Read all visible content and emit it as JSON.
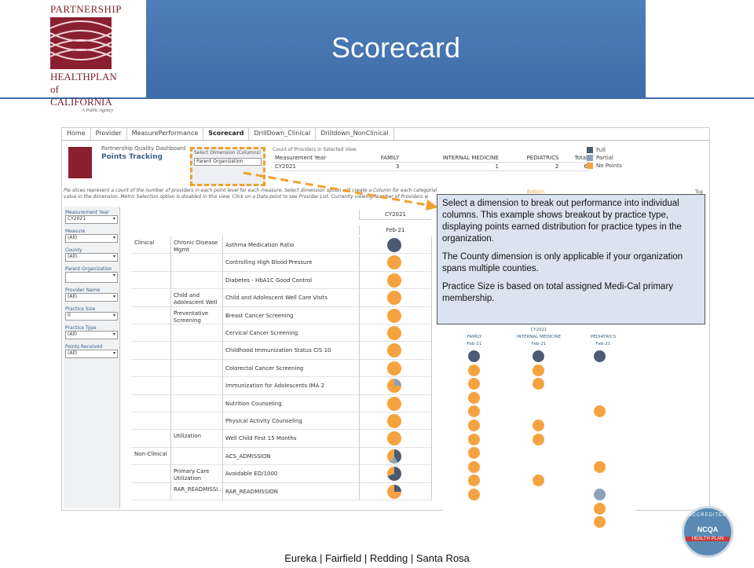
{
  "slide": {
    "title": "Scorecard",
    "footer": "Eureka   |   Fairfield   |   Redding   |   Santa Rosa"
  },
  "logo": {
    "line1": "PARTNERSHIP",
    "line2": "HEALTHPLAN",
    "line3": "of CALIFORNIA",
    "tagline": "A Public Agency"
  },
  "badge": {
    "top": "ACCREDITED",
    "mid": "NCQA",
    "bottom": "HEALTH PLAN"
  },
  "dashboard": {
    "tabs": [
      "Home",
      "Provider",
      "MeasurePerformance",
      "Scorecard",
      "DrillDown_Clinical",
      "Drilldown_NonClinical"
    ],
    "active_tab": "Scorecard",
    "title": "Partnership Quality Dashboard",
    "subtitle": "Points Tracking",
    "select_dimension_label": "Select Dimension (Columns)",
    "select_dimension_value": "Parent Organization",
    "count_caption": "Count of Providers in Selected View",
    "count_headers": [
      "Measurement Year",
      "FAMILY",
      "INTERNAL MEDICINE",
      "PEDIATRICS",
      "Total"
    ],
    "count_row": [
      "CY2021",
      "3",
      "1",
      "2",
      "6"
    ],
    "legend": [
      {
        "label": "Full",
        "color": "#4a5b73"
      },
      {
        "label": "Partial",
        "color": "#8da1b8"
      },
      {
        "label": "No Points",
        "color": "#f5a340"
      }
    ],
    "note": "Pie slices represent a count of the number of providers in each point level for each measure. Select dimension option will create a Column for each categorial value in the dimension. Metric Selection option is disabled in this view. Click on a Data point to see Provider List. Currently viewing Number of Providers w",
    "filters": [
      {
        "label": "Measurement Year",
        "value": "CY2021"
      },
      {
        "label": "Measure",
        "value": "(All)"
      },
      {
        "label": "County",
        "value": "(All)"
      },
      {
        "label": "Parent Organization",
        "value": ""
      },
      {
        "label": "Provider Name",
        "value": "(All)"
      },
      {
        "label": "Practice Size",
        "value": "0"
      },
      {
        "label": "Practice Type",
        "value": "(All)"
      },
      {
        "label": "Points Received",
        "value": "(All)"
      }
    ],
    "col_year": "CY2021",
    "col_month": "Feb-21",
    "rows": [
      {
        "group": "Clinical",
        "sub": "Chronic Disease Mgmt",
        "measure": "Asthma Medication Ratio",
        "dot": "nv"
      },
      {
        "group": "",
        "sub": "",
        "measure": "Controlling High Blood Pressure",
        "dot": "or"
      },
      {
        "group": "",
        "sub": "",
        "measure": "Diabetes - HbA1C Good Control",
        "dot": "or"
      },
      {
        "group": "",
        "sub": "Child and Adolescent Well ..",
        "measure": "Child and Adolescent Well Care Visits",
        "dot": "or"
      },
      {
        "group": "",
        "sub": "Preventative Screening",
        "measure": "Breast Cancer Screening",
        "dot": "or"
      },
      {
        "group": "",
        "sub": "",
        "measure": "Cervical Cancer Screening",
        "dot": "or"
      },
      {
        "group": "",
        "sub": "",
        "measure": "Childhood Immunization Status CIS 10",
        "dot": "or"
      },
      {
        "group": "",
        "sub": "",
        "measure": "Colorectal Cancer Screening",
        "dot": "or"
      },
      {
        "group": "",
        "sub": "",
        "measure": "Immunization for Adolescents IMA 2",
        "dot": "pie1"
      },
      {
        "group": "",
        "sub": "",
        "measure": "Nutrition Counseling",
        "dot": "or"
      },
      {
        "group": "",
        "sub": "",
        "measure": "Physical Activity Counseling",
        "dot": "or"
      },
      {
        "group": "",
        "sub": "Utilization",
        "measure": "Well Child First 15 Months",
        "dot": "or"
      },
      {
        "group": "Non-Clinical",
        "sub": "",
        "measure": "ACS_ADMISSION",
        "dot": "pie2"
      },
      {
        "group": "",
        "sub": "Primary Care Utilization",
        "measure": "Avoidable ED/1000",
        "dot": "pie3"
      },
      {
        "group": "",
        "sub": "RAR_READMISSI..",
        "measure": "RAR_READMISSION",
        "dot": "pie4"
      }
    ],
    "breakout": {
      "year": "CY2021",
      "cols": [
        "FAMILY",
        "INTERNAL MEDICINE",
        "PEDIATRICS"
      ],
      "month": "Feb-21"
    },
    "bottom_hint": "Bottom",
    "top_hint": "Top"
  },
  "callout": {
    "p1": "Select a dimension to break out performance into individual columns. This example shows breakout by practice type, displaying points earned distribution for practice types in the organization.",
    "p2": "The County dimension is only applicable if your organization spans multiple counties.",
    "p3": "Practice Size is based on total assigned Medi-Cal primary membership."
  }
}
